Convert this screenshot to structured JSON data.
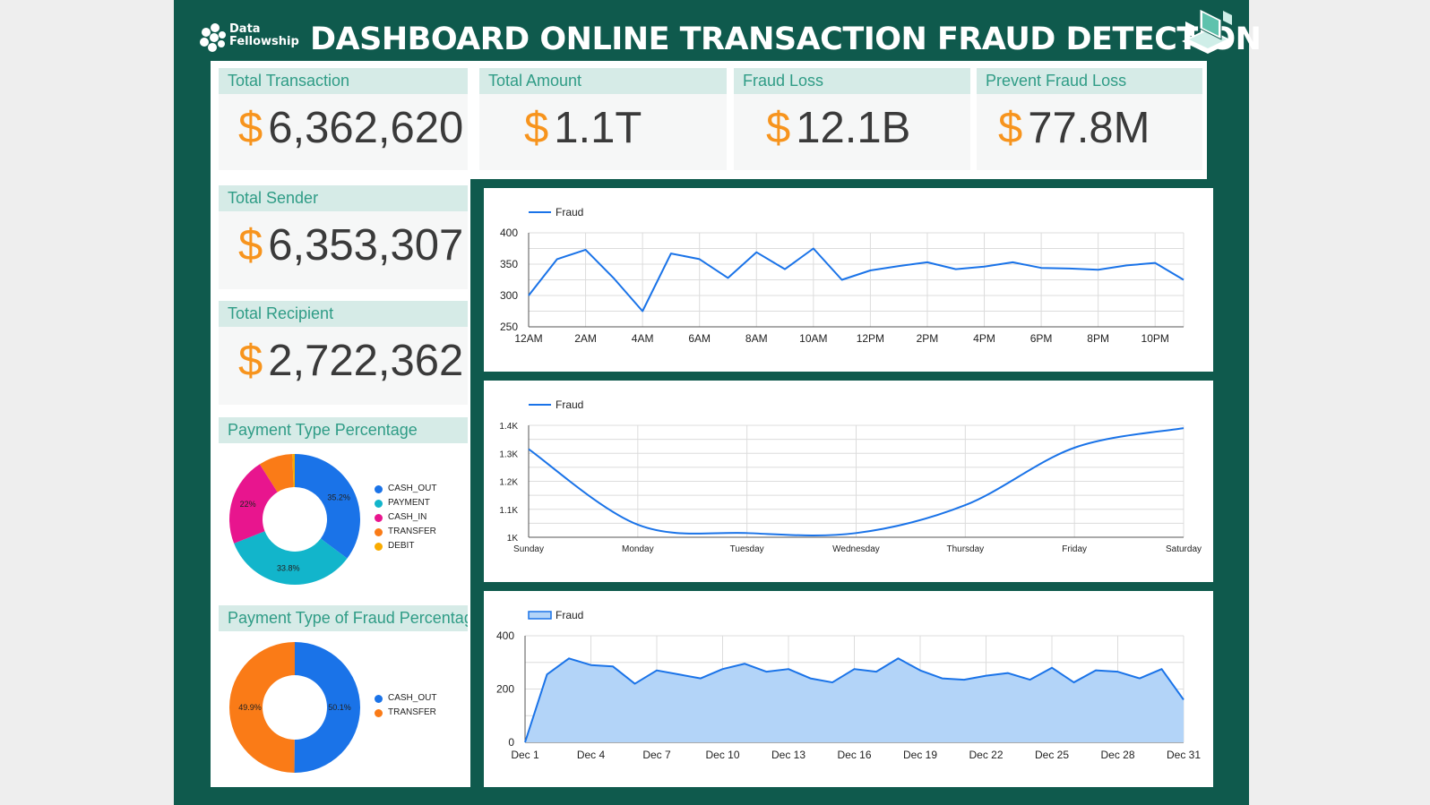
{
  "header": {
    "logo_line1": "Data",
    "logo_line2": "Fellowship",
    "title": "DASHBOARD ONLINE TRANSACTION FRAUD DETECTION"
  },
  "icons": {
    "logo": "data-fellowship-logo-icon",
    "header_right": "laptop-isometric-icon"
  },
  "kpis": [
    {
      "label": "Total Transaction",
      "currency": "$",
      "value": "6,362,620"
    },
    {
      "label": "Total Amount",
      "currency": "$",
      "value": "1.1T"
    },
    {
      "label": "Fraud Loss",
      "currency": "$",
      "value": "12.1B"
    },
    {
      "label": "Prevent Fraud Loss",
      "currency": "$",
      "value": "77.8M"
    },
    {
      "label": "Total Sender",
      "currency": "$",
      "value": "6,353,307"
    },
    {
      "label": "Total Recipient",
      "currency": "$",
      "value": "2,722,362"
    }
  ],
  "colors": {
    "accent": "#f7941d",
    "frame": "#0f5a4d",
    "header_bg": "#d6ebe7",
    "header_text": "#2f9c86",
    "line": "#1a73e8",
    "area_fill": "#b3d4f8"
  },
  "chart_data": [
    {
      "type": "line",
      "legend": [
        "Fraud"
      ],
      "x": [
        "12AM",
        "1AM",
        "2AM",
        "3AM",
        "4AM",
        "5AM",
        "6AM",
        "7AM",
        "8AM",
        "9AM",
        "10AM",
        "11AM",
        "12PM",
        "1PM",
        "2PM",
        "3PM",
        "4PM",
        "5PM",
        "6PM",
        "7PM",
        "8PM",
        "9PM",
        "10PM",
        "11PM"
      ],
      "xticks": [
        "12AM",
        "2AM",
        "4AM",
        "6AM",
        "8AM",
        "10AM",
        "12PM",
        "2PM",
        "4PM",
        "6PM",
        "8PM",
        "10PM"
      ],
      "series": [
        {
          "name": "Fraud",
          "values": [
            300,
            358,
            373,
            327,
            275,
            367,
            358,
            328,
            369,
            342,
            375,
            325,
            340,
            347,
            353,
            342,
            346,
            353,
            344,
            343,
            341,
            348,
            352,
            325
          ]
        }
      ],
      "yticks": [
        "250",
        "300",
        "350",
        "400"
      ],
      "ylim": [
        250,
        400
      ],
      "legend_position": "top-left",
      "grid": true
    },
    {
      "type": "line",
      "legend": [
        "Fraud"
      ],
      "x": [
        "Sunday",
        "Monday",
        "Tuesday",
        "Wednesday",
        "Thursday",
        "Friday",
        "Saturday"
      ],
      "series": [
        {
          "name": "Fraud",
          "values": [
            1315,
            1045,
            1015,
            1015,
            1115,
            1320,
            1390
          ]
        }
      ],
      "yticks": [
        "1K",
        "1.1K",
        "1.2K",
        "1.3K",
        "1.4K"
      ],
      "ylim": [
        1000,
        1400
      ],
      "legend_position": "top-left",
      "grid": true
    },
    {
      "type": "area",
      "legend": [
        "Fraud"
      ],
      "x": [
        "Dec 1",
        "Dec 2",
        "Dec 3",
        "Dec 4",
        "Dec 5",
        "Dec 6",
        "Dec 7",
        "Dec 8",
        "Dec 9",
        "Dec 10",
        "Dec 11",
        "Dec 12",
        "Dec 13",
        "Dec 14",
        "Dec 15",
        "Dec 16",
        "Dec 17",
        "Dec 18",
        "Dec 19",
        "Dec 20",
        "Dec 21",
        "Dec 22",
        "Dec 23",
        "Dec 24",
        "Dec 25",
        "Dec 26",
        "Dec 27",
        "Dec 28",
        "Dec 29",
        "Dec 30",
        "Dec 31"
      ],
      "xticks": [
        "Dec 1",
        "Dec 4",
        "Dec 7",
        "Dec 10",
        "Dec 13",
        "Dec 16",
        "Dec 19",
        "Dec 22",
        "Dec 25",
        "Dec 28",
        "Dec 31"
      ],
      "series": [
        {
          "name": "Fraud",
          "values": [
            0,
            255,
            315,
            290,
            285,
            220,
            270,
            255,
            240,
            275,
            295,
            265,
            275,
            240,
            225,
            275,
            265,
            315,
            270,
            240,
            235,
            250,
            260,
            235,
            280,
            225,
            270,
            265,
            240,
            275,
            160
          ]
        }
      ],
      "yticks": [
        "0",
        "200",
        "400"
      ],
      "ylim": [
        0,
        400
      ],
      "legend_position": "top-left",
      "grid": true
    },
    {
      "type": "pie",
      "title": "Payment Type Percentage",
      "categories": [
        "CASH_OUT",
        "PAYMENT",
        "CASH_IN",
        "TRANSFER",
        "DEBIT"
      ],
      "values": [
        35.2,
        33.8,
        22.0,
        8.4,
        0.6
      ],
      "labels": [
        "35.2%",
        "33.8%",
        "22%",
        "",
        ""
      ],
      "colors": [
        "#1a73e8",
        "#12b5cb",
        "#e8158e",
        "#fa7b17",
        "#f9ab00"
      ],
      "legend_position": "right"
    },
    {
      "type": "pie",
      "title": "Payment Type of Fraud Percentage",
      "categories": [
        "CASH_OUT",
        "TRANSFER"
      ],
      "values": [
        50.1,
        49.9
      ],
      "labels": [
        "50.1%",
        "49.9%"
      ],
      "colors": [
        "#1a73e8",
        "#fa7b17"
      ],
      "legend_position": "right"
    }
  ]
}
